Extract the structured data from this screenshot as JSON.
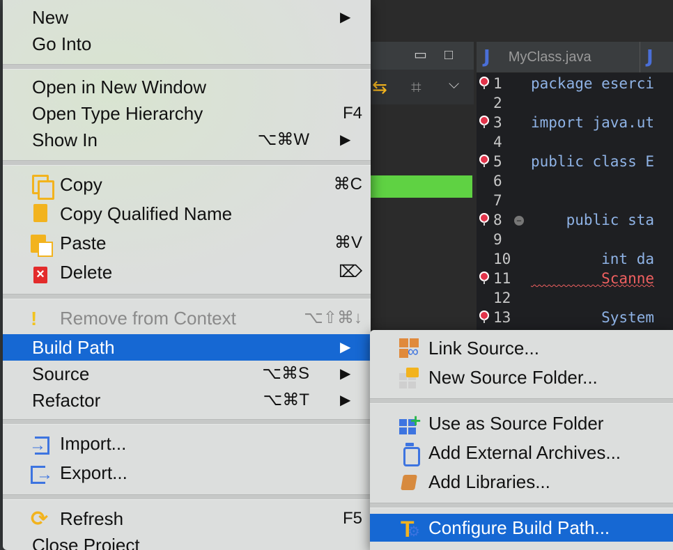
{
  "editor": {
    "tabs": [
      {
        "icon": "J",
        "label": "MyClass.java"
      },
      {
        "icon": "J",
        "label": ""
      }
    ],
    "lines": [
      {
        "num": "1",
        "text": "package eserci",
        "marker": true,
        "err": false
      },
      {
        "num": "2",
        "text": "",
        "marker": false,
        "err": false
      },
      {
        "num": "3",
        "text": "import java.ut",
        "marker": true,
        "err": false
      },
      {
        "num": "4",
        "text": "",
        "marker": false,
        "err": false
      },
      {
        "num": "5",
        "text": "public class E",
        "marker": true,
        "err": false
      },
      {
        "num": "6",
        "text": "",
        "marker": false,
        "err": false
      },
      {
        "num": "7",
        "text": "",
        "marker": false,
        "err": false
      },
      {
        "num": "8",
        "text": "    public sta",
        "marker": true,
        "err": false
      },
      {
        "num": "9",
        "text": "",
        "marker": false,
        "err": false
      },
      {
        "num": "10",
        "text": "        int da",
        "marker": false,
        "err": false
      },
      {
        "num": "11",
        "text": "        Scanne",
        "marker": true,
        "err": true
      },
      {
        "num": "12",
        "text": "",
        "marker": false,
        "err": false
      },
      {
        "num": "13",
        "text": "        System",
        "marker": true,
        "err": false
      }
    ]
  },
  "menu": {
    "new": {
      "label": "New",
      "arrow": "▶"
    },
    "go_into": {
      "label": "Go Into"
    },
    "open_new_window": {
      "label": "Open in New Window"
    },
    "open_type_hierarchy": {
      "label": "Open Type Hierarchy",
      "shortcut": "F4"
    },
    "show_in": {
      "label": "Show In",
      "shortcut": "⌥⌘W",
      "arrow": "▶"
    },
    "copy": {
      "label": "Copy",
      "shortcut": "⌘C"
    },
    "copy_qualified": {
      "label": "Copy Qualified Name"
    },
    "paste": {
      "label": "Paste",
      "shortcut": "⌘V"
    },
    "delete": {
      "label": "Delete",
      "shortcut": "⌦"
    },
    "remove_context": {
      "label": "Remove from Context",
      "shortcut": "⌥⇧⌘↓"
    },
    "build_path": {
      "label": "Build Path",
      "arrow": "▶"
    },
    "source": {
      "label": "Source",
      "shortcut": "⌥⌘S",
      "arrow": "▶"
    },
    "refactor": {
      "label": "Refactor",
      "shortcut": "⌥⌘T",
      "arrow": "▶"
    },
    "import": {
      "label": "Import..."
    },
    "export": {
      "label": "Export..."
    },
    "refresh": {
      "label": "Refresh",
      "shortcut": "F5"
    },
    "close_project": {
      "label": "Close Project"
    }
  },
  "submenu": {
    "link_source": {
      "label": "Link Source..."
    },
    "new_source_folder": {
      "label": "New Source Folder..."
    },
    "use_as_source": {
      "label": "Use as Source Folder"
    },
    "add_external": {
      "label": "Add External Archives..."
    },
    "add_libraries": {
      "label": "Add Libraries..."
    },
    "configure": {
      "label": "Configure Build Path..."
    }
  },
  "colors": {
    "highlight": "#1668d3",
    "menu_bg": "#dcdedd",
    "error_red": "#f06060"
  }
}
